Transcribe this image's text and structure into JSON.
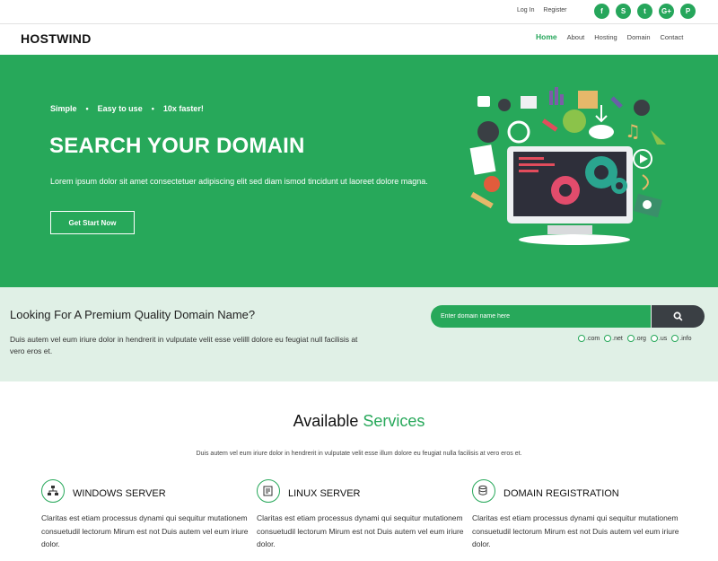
{
  "topbar": {
    "login": "Log In",
    "register": "Register",
    "socials": [
      {
        "icon": "facebook-icon",
        "glyph": "f"
      },
      {
        "icon": "skype-icon",
        "glyph": "S"
      },
      {
        "icon": "twitter-icon",
        "glyph": "t"
      },
      {
        "icon": "google-plus-icon",
        "glyph": "G+"
      },
      {
        "icon": "pinterest-icon",
        "glyph": "P"
      }
    ]
  },
  "brand": {
    "logo": "HOSTWIND",
    "accent_color": "#27a85a"
  },
  "nav": {
    "items": [
      "Home",
      "About",
      "Hosting",
      "Domain",
      "Contact"
    ],
    "active": "Home"
  },
  "hero": {
    "features": [
      "Simple",
      "Easy to use",
      "10x faster!"
    ],
    "title": "SEARCH YOUR DOMAIN",
    "description": "Lorem ipsum dolor sit amet consectetuer adipiscing elit sed diam ismod tincidunt ut laoreet dolore magna.",
    "button": "Get Start Now"
  },
  "search_band": {
    "title": "Looking For A Premium Quality Domain Name?",
    "description": "Duis autem vel eum iriure dolor in hendrerit in vulputate velit esse velilll dolore eu feugiat null facilisis at vero eros et.",
    "input_placeholder": "Enter domain name here",
    "search_icon": "search-icon",
    "tlds": [
      ".com",
      ".net",
      ".org",
      ".us",
      ".info"
    ]
  },
  "services": {
    "title_main": "Available",
    "title_accent": "Services",
    "description": "Duis autem vel eum iriure dolor in hendrerit in vulputate velit esse illum dolore eu feugiat nulla facilisis at vero eros et.",
    "items": [
      {
        "name": "WINDOWS SERVER",
        "icon": "network-icon",
        "text": "Claritas est etiam processus dynami qui sequitur mutationem consuetudil lectorum Mirum est not Duis autem vel eum iriure dolor."
      },
      {
        "name": "LINUX SERVER",
        "icon": "server-icon",
        "text": "Claritas est etiam processus dynami qui sequitur mutationem consuetudil lectorum Mirum est not Duis autem vel eum iriure dolor."
      },
      {
        "name": "DOMAIN REGISTRATION",
        "icon": "database-icon",
        "text": "Claritas est etiam processus dynami qui sequitur mutationem consuetudil lectorum Mirum est not Duis autem vel eum iriure dolor."
      }
    ]
  }
}
